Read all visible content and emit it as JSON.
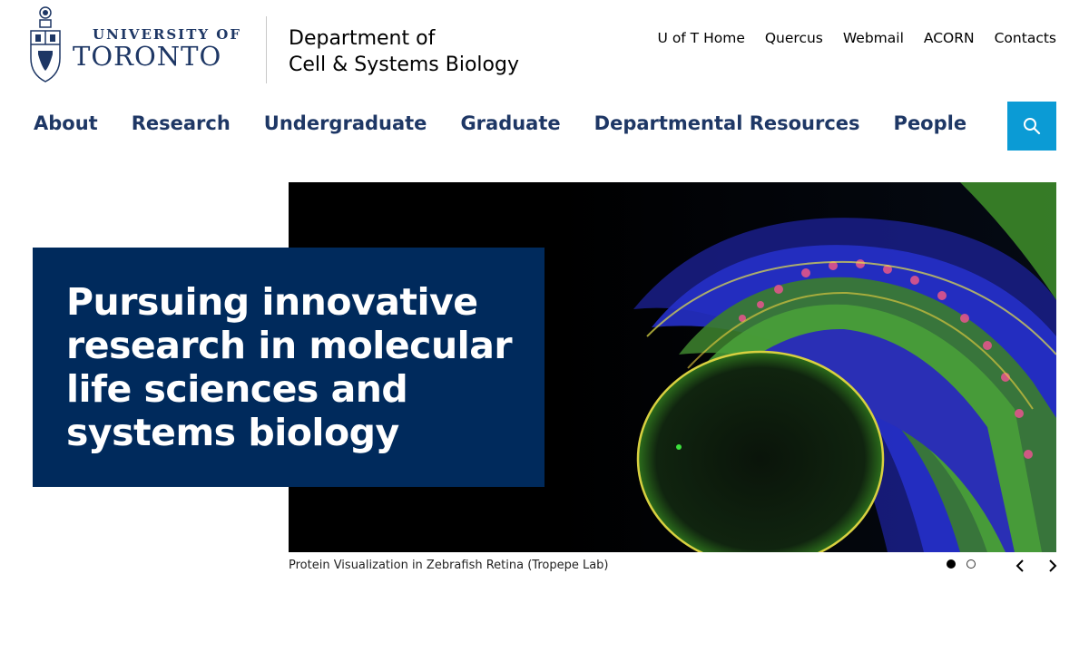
{
  "header": {
    "university_line1": "UNIVERSITY OF",
    "university_line2": "TORONTO",
    "department_line1": "Department of",
    "department_line2": "Cell & Systems Biology"
  },
  "utility_nav": [
    "U of T Home",
    "Quercus",
    "Webmail",
    "ACORN",
    "Contacts"
  ],
  "main_nav": [
    "About",
    "Research",
    "Undergraduate",
    "Graduate",
    "Departmental Resources",
    "People"
  ],
  "search": {
    "icon": "search-icon"
  },
  "hero": {
    "headline_lines": [
      "Pursuing innovative",
      "research in molecular",
      "life sciences and",
      "systems biology"
    ],
    "caption": "Protein Visualization in Zebrafish Retina (Tropepe Lab)",
    "slide_count": 2,
    "active_slide": 1
  },
  "colors": {
    "brand_navy": "#1e3765",
    "headline_box": "#002a5c",
    "search_button": "#0b9bd5"
  }
}
